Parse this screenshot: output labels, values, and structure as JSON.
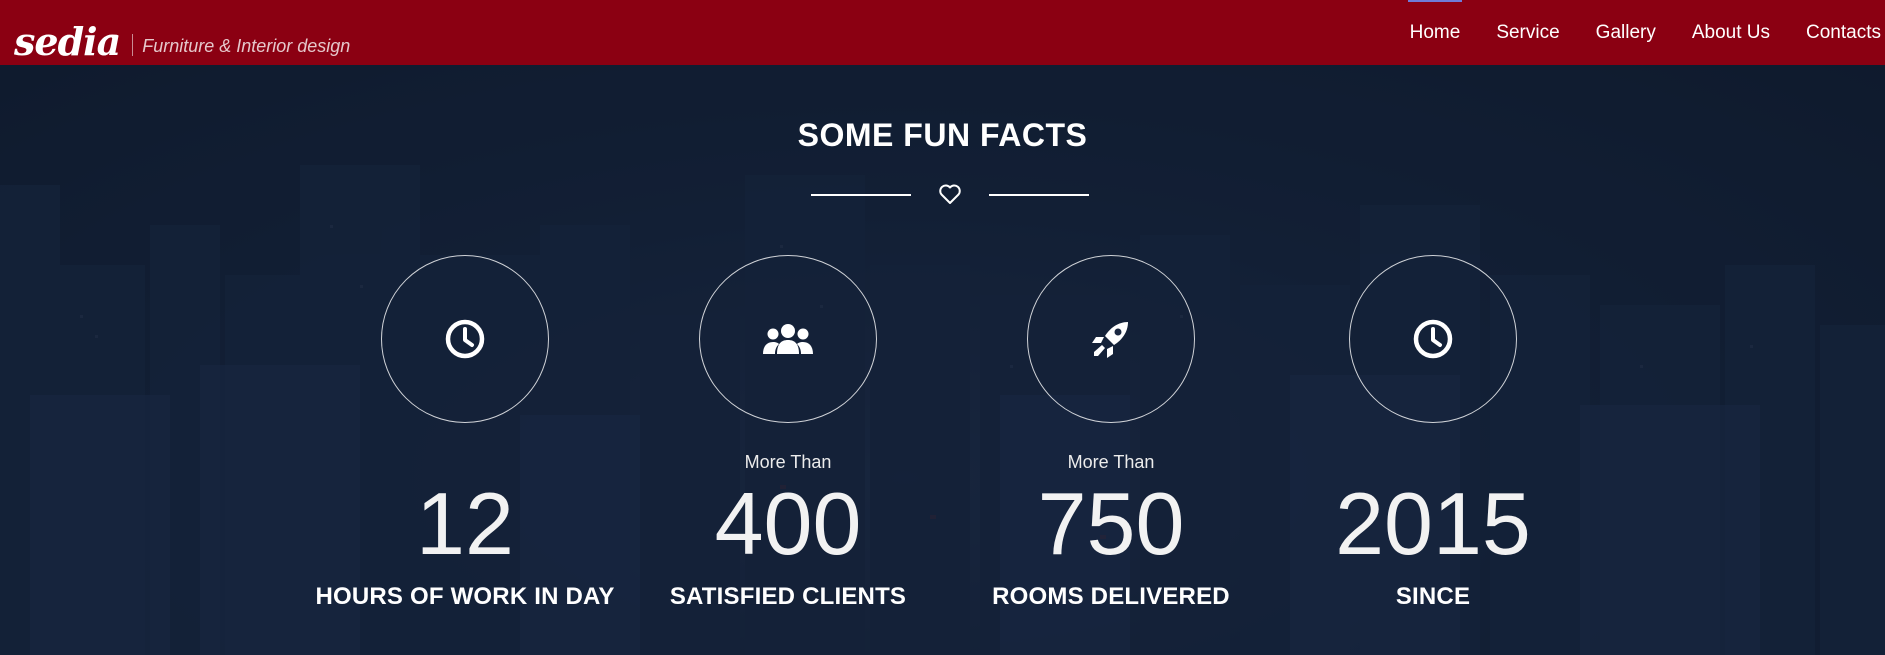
{
  "header": {
    "logo_text": "sedia",
    "tagline": "Furniture & Interior design",
    "nav": [
      {
        "label": "Home",
        "active": true
      },
      {
        "label": "Service",
        "active": false
      },
      {
        "label": "Gallery",
        "active": false
      },
      {
        "label": "About Us",
        "active": false
      },
      {
        "label": "Contacts",
        "active": false
      }
    ],
    "colors": {
      "bar": "#8b0012",
      "active_indicator": "#6f7bd8"
    }
  },
  "section": {
    "title": "SOME FUN FACTS",
    "divider_icon": "heart-outline-icon"
  },
  "facts": [
    {
      "icon": "clock-icon",
      "prefix": "",
      "number": "12",
      "label": "HOURS OF WORK IN DAY"
    },
    {
      "icon": "users-icon",
      "prefix": "More Than",
      "number": "400",
      "label": "SATISFIED CLIENTS"
    },
    {
      "icon": "rocket-icon",
      "prefix": "More Than",
      "number": "750",
      "label": "ROOMS DELIVERED"
    },
    {
      "icon": "clock-icon",
      "prefix": "",
      "number": "2015",
      "label": "SINCE"
    }
  ]
}
